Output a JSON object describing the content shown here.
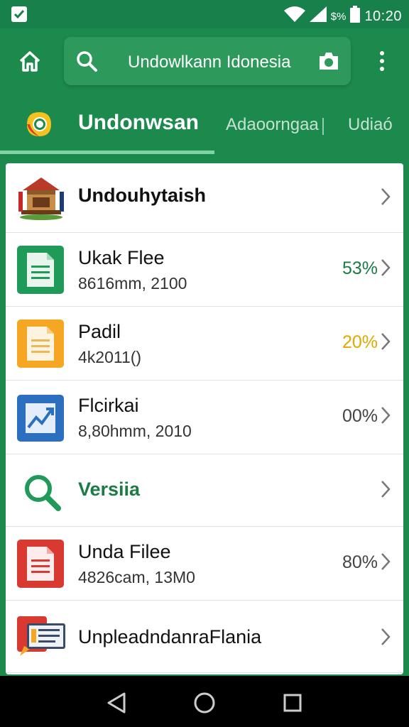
{
  "status_bar": {
    "battery_percent": "$%",
    "time": "10:20"
  },
  "search": {
    "query": "Undowlkann Idonesia"
  },
  "tabs": [
    {
      "label": "Undonwsan",
      "active": true
    },
    {
      "label": "Adaoorngaa",
      "active": false
    },
    {
      "label": "Udiaó",
      "active": false
    }
  ],
  "list": [
    {
      "icon": "house-illustration-icon",
      "title": "Undouhytaish",
      "subtitle": "",
      "percent": ""
    },
    {
      "icon": "green-document-icon",
      "title": "Ukak Flee",
      "subtitle": "8616mm, 2100",
      "percent": "53%",
      "percent_color": "#1c7a44"
    },
    {
      "icon": "yellow-document-icon",
      "title": "Padil",
      "subtitle": "4k2011()",
      "percent": "20%",
      "percent_color": "#e0a800"
    },
    {
      "icon": "blue-chart-icon",
      "title": "Flcirkai",
      "subtitle": "8,80hmm, 2010",
      "percent": "00%",
      "percent_color": "#444444"
    },
    {
      "icon": "green-search-icon",
      "title": "Versiia",
      "subtitle": "",
      "percent": ""
    },
    {
      "icon": "red-document-icon",
      "title": "Unda Filee",
      "subtitle": "4826cam, 13M0",
      "percent": "80%",
      "percent_color": "#444444"
    },
    {
      "icon": "presentation-icon",
      "title": "UnpleadndanraFlania",
      "subtitle": "",
      "percent": ""
    }
  ],
  "colors": {
    "primary": "#1c8a4c",
    "search_box": "#2d9a5c",
    "tab_indicator": "#7fd3a4"
  }
}
